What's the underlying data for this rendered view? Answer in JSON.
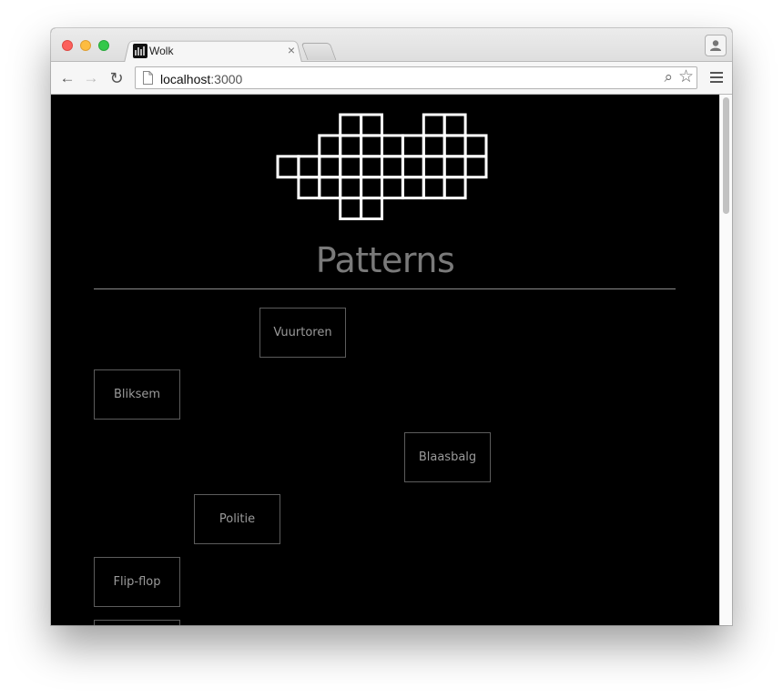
{
  "browser": {
    "tab_title": "Wolk",
    "tab_close": "×",
    "url_host": "localhost",
    "url_port": ":3000",
    "back_glyph": "←",
    "forward_glyph": "→",
    "reload_glyph": "↻",
    "zoom_glyph": "⌕",
    "star_glyph": "☆"
  },
  "page": {
    "title": "Patterns",
    "patterns": [
      {
        "label": "Vuurtoren"
      },
      {
        "label": "Bliksem"
      },
      {
        "label": "Blaasbalg"
      },
      {
        "label": "Politie"
      },
      {
        "label": "Flip-flop"
      },
      {
        "label": ""
      }
    ]
  },
  "logo_grid": {
    "rows": [
      [
        3,
        4,
        7,
        8
      ],
      [
        2,
        3,
        4,
        5,
        6,
        7,
        8,
        9
      ],
      [
        0,
        1,
        2,
        3,
        4,
        5,
        6,
        7,
        8,
        9
      ],
      [
        1,
        2,
        3,
        4,
        5,
        6,
        7,
        8
      ],
      [
        3,
        4
      ]
    ]
  },
  "colors": {
    "background": "#000000",
    "text": "#8a8a8a",
    "logo": "#ffffff"
  },
  "icons": {
    "favicon": "wolk-favicon-icon",
    "page": "page-icon",
    "profile": "profile-icon",
    "menu": "hamburger-menu-icon"
  }
}
